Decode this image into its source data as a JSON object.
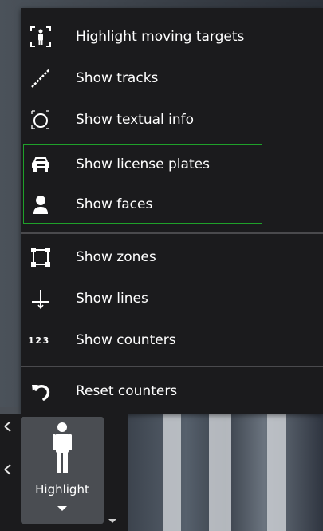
{
  "menu": {
    "items": [
      {
        "label": "Highlight moving targets",
        "icon": "target-person-icon"
      },
      {
        "label": "Show tracks",
        "icon": "track-line-icon"
      },
      {
        "label": "Show textual info",
        "icon": "textual-info-icon"
      },
      {
        "label": "Show license plates",
        "icon": "car-icon"
      },
      {
        "label": "Show faces",
        "icon": "face-person-icon"
      },
      {
        "label": "Show zones",
        "icon": "zone-square-icon"
      },
      {
        "label": "Show lines",
        "icon": "line-cross-icon"
      },
      {
        "label": "Show counters",
        "icon": "counter-123-icon",
        "icon_text": "123"
      },
      {
        "label": "Reset counters",
        "icon": "reset-arrow-icon"
      }
    ]
  },
  "toolbar": {
    "highlight_label": "Highlight"
  },
  "colors": {
    "menu_bg": "#1b1b1d",
    "group_border": "#1fa12a",
    "button_bg": "#4a4d52",
    "text": "#ffffff"
  }
}
